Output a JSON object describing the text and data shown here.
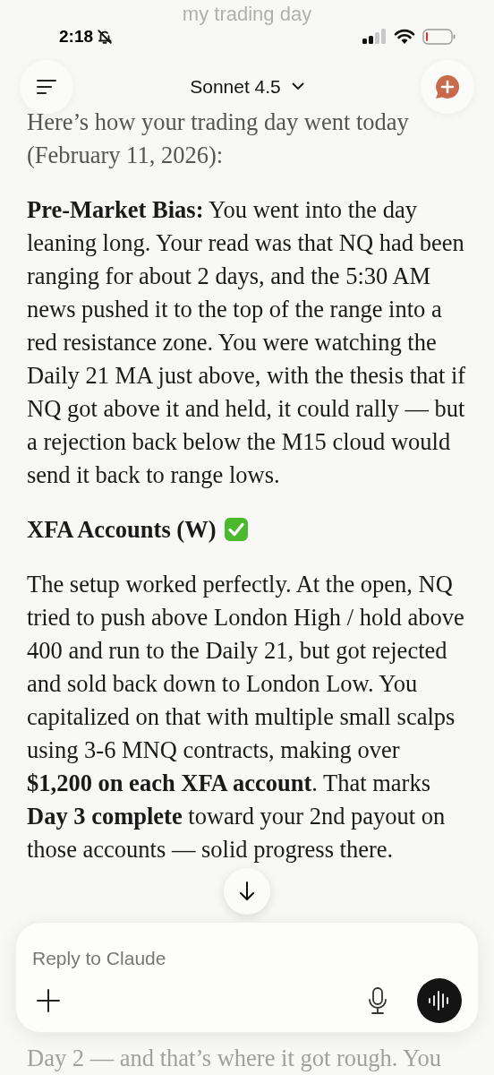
{
  "behind_top": "my trading day",
  "status_bar": {
    "time": "2:18"
  },
  "header": {
    "model": "Sonnet 4.5"
  },
  "message": [
    {
      "kind": "paragraph",
      "text": "Here’s how your trading day went today (February 11, 2026):"
    },
    {
      "kind": "paragraph",
      "text": "**Pre-Market Bias:** You went into the day leaning long. Your read was that NQ had been ranging for about 2 days, and the 5:30 AM news pushed it to the top of the range into a red resistance zone. You were watching the Daily 21 MA just above, with the thesis that if NQ got above it and held, it could rally — but a rejection back below the M15 cloud would send it back to range lows."
    },
    {
      "kind": "heading",
      "text": "XFA Accounts (W)"
    },
    {
      "kind": "paragraph",
      "text": "The setup worked perfectly. At the open, NQ tried to push above London High / hold above 400 and run to the Daily 21, but got rejected and sold back down to London Low. You capitalized on that with multiple small scalps using 3-6 MNQ contracts, making over **$1,200 on each XFA account**. That marks **Day 3 complete** toward your 2nd payout on those accounts — solid progress there."
    }
  ],
  "composer": {
    "placeholder": "Reply to Claude"
  },
  "behind_bottom": "Day 2 — and that’s where it got rough. You"
}
